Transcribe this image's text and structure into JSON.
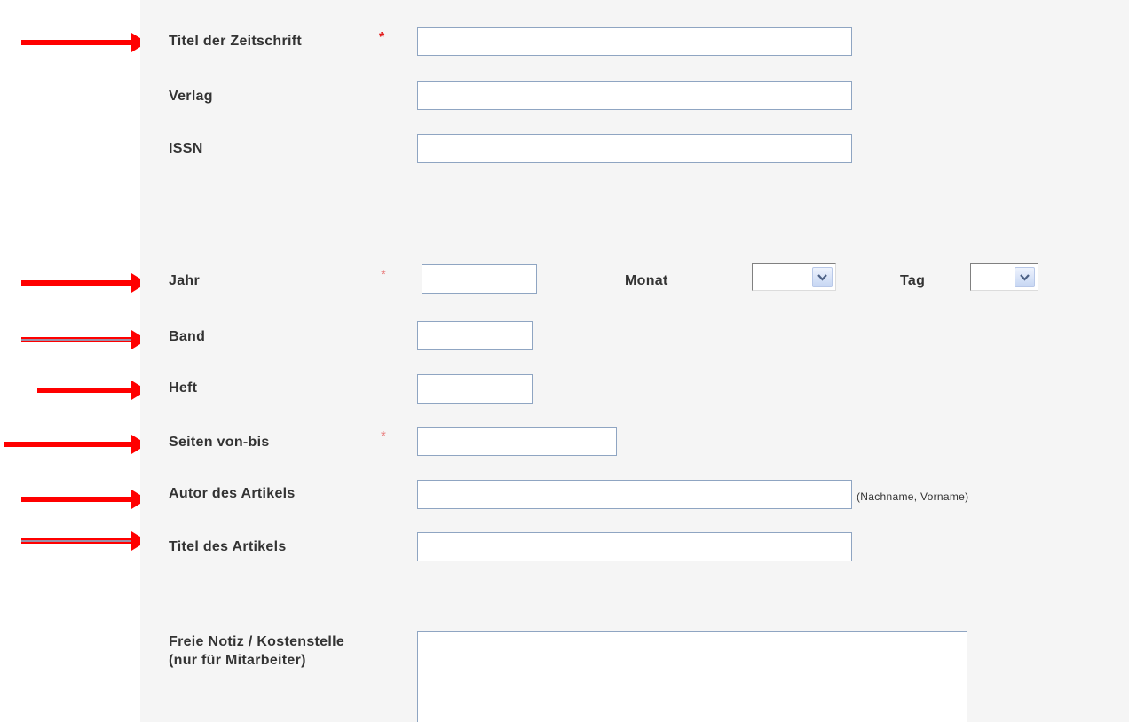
{
  "form": {
    "journal_title": {
      "label": "Titel der Zeitschrift",
      "required_mark": "*",
      "value": ""
    },
    "publisher": {
      "label": "Verlag",
      "value": ""
    },
    "issn": {
      "label": "ISSN",
      "value": ""
    },
    "year": {
      "label": "Jahr",
      "required_mark": "*",
      "value": ""
    },
    "month": {
      "label": "Monat",
      "selected": ""
    },
    "day": {
      "label": "Tag",
      "selected": ""
    },
    "volume": {
      "label": "Band",
      "value": ""
    },
    "issue": {
      "label": "Heft",
      "value": ""
    },
    "pages": {
      "label": "Seiten von-bis",
      "required_mark": "*",
      "value": ""
    },
    "article_author": {
      "label": "Autor des Artikels",
      "value": "",
      "hint": "(Nachname, Vorname)"
    },
    "article_title": {
      "label": "Titel des Artikels",
      "value": ""
    },
    "note": {
      "label": "Freie Notiz / Kostenstelle (nur für Mitarbeiter)",
      "value": ""
    }
  },
  "annotations": {
    "arrow_color": "#ff0000",
    "arrow_count": 8
  },
  "colors": {
    "panel_background": "#f5f5f5",
    "field_border": "#8fa5c2",
    "required_mark": "#e21b1b",
    "label_text": "#333333"
  },
  "icons": {
    "dropdown": "chevron-down-icon",
    "annotation": "red-arrow-icon"
  }
}
